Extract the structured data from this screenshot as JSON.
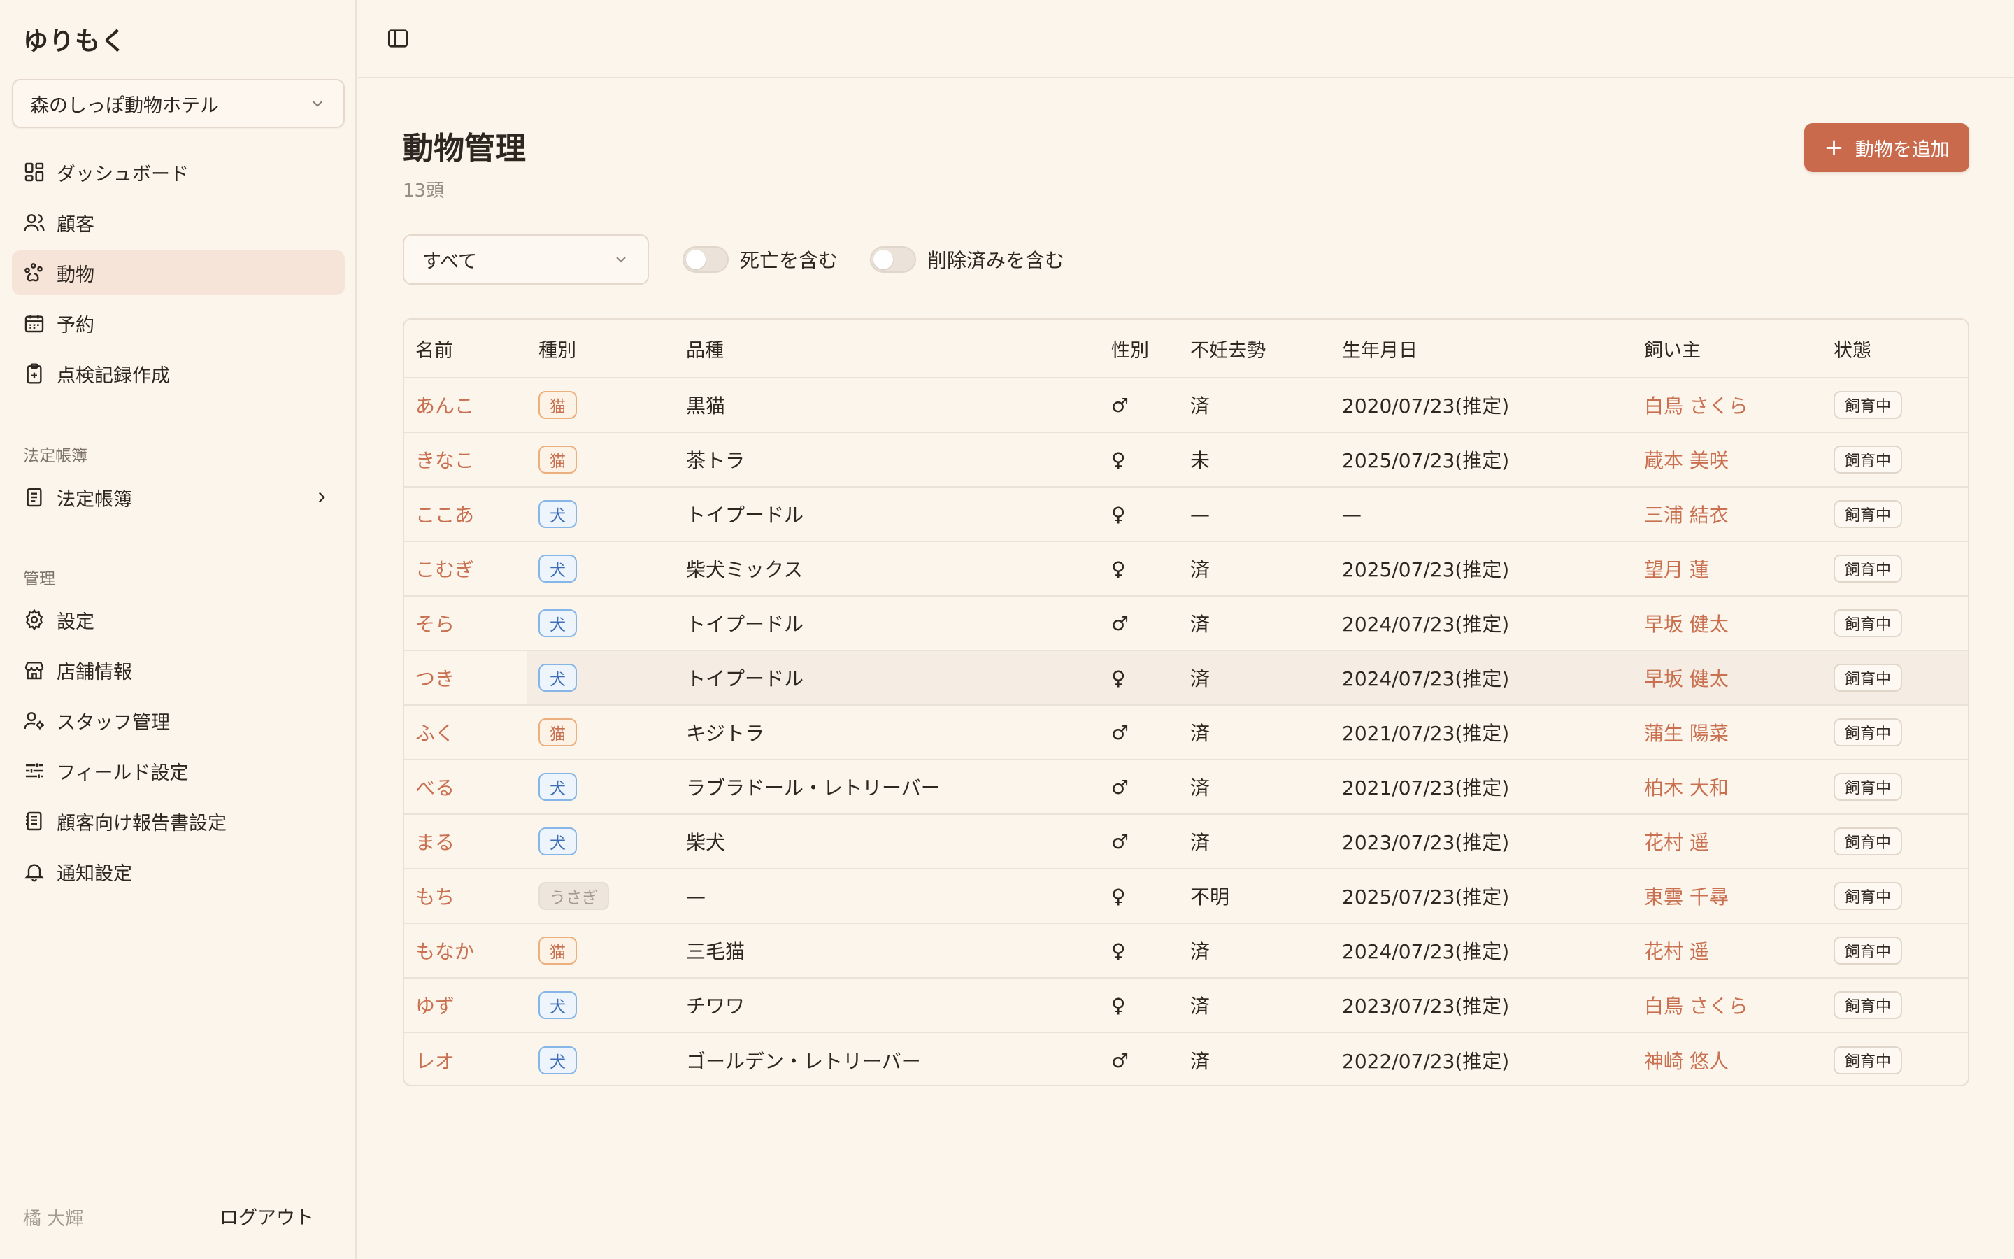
{
  "app": {
    "brand": "ゆりもく"
  },
  "sidebar": {
    "store": "森のしっぽ動物ホテル",
    "main_items": [
      {
        "label": "ダッシュボード",
        "icon": "dashboard-icon"
      },
      {
        "label": "顧客",
        "icon": "users-icon"
      },
      {
        "label": "動物",
        "icon": "paw-icon",
        "active": true
      },
      {
        "label": "予約",
        "icon": "calendar-icon"
      },
      {
        "label": "点検記録作成",
        "icon": "clipboard-plus-icon"
      }
    ],
    "section_legal": "法定帳簿",
    "legal_item": {
      "label": "法定帳簿",
      "icon": "ledger-icon"
    },
    "section_admin": "管理",
    "admin_items": [
      {
        "label": "設定",
        "icon": "gear-icon"
      },
      {
        "label": "店舗情報",
        "icon": "store-icon"
      },
      {
        "label": "スタッフ管理",
        "icon": "staff-icon"
      },
      {
        "label": "フィールド設定",
        "icon": "sliders-icon"
      },
      {
        "label": "顧客向け報告書設定",
        "icon": "report-icon"
      },
      {
        "label": "通知設定",
        "icon": "bell-icon"
      }
    ],
    "user": "橘 大輝",
    "logout": "ログアウト"
  },
  "main": {
    "title": "動物管理",
    "count": "13頭",
    "add_button": "動物を追加",
    "filter": {
      "selected": "すべて"
    },
    "toggles": [
      {
        "label": "死亡を含む",
        "on": false
      },
      {
        "label": "削除済みを含む",
        "on": false
      }
    ]
  },
  "table": {
    "headers": [
      "名前",
      "種別",
      "品種",
      "性別",
      "不妊去勢",
      "生年月日",
      "飼い主",
      "状態"
    ],
    "rows": [
      [
        "あんこ",
        "猫",
        "黒猫",
        "♂",
        "済",
        "2020/07/23(推定)",
        "白鳥 さくら",
        "飼育中"
      ],
      [
        "きなこ",
        "猫",
        "茶トラ",
        "♀",
        "未",
        "2025/07/23(推定)",
        "蔵本 美咲",
        "飼育中"
      ],
      [
        "ここあ",
        "犬",
        "トイプードル",
        "♀",
        "—",
        "—",
        "三浦 結衣",
        "飼育中"
      ],
      [
        "こむぎ",
        "犬",
        "柴犬ミックス",
        "♀",
        "済",
        "2025/07/23(推定)",
        "望月 蓮",
        "飼育中"
      ],
      [
        "そら",
        "犬",
        "トイプードル",
        "♂",
        "済",
        "2024/07/23(推定)",
        "早坂 健太",
        "飼育中"
      ],
      [
        "つき",
        "犬",
        "トイプードル",
        "♀",
        "済",
        "2024/07/23(推定)",
        "早坂 健太",
        "飼育中"
      ],
      [
        "ふく",
        "猫",
        "キジトラ",
        "♂",
        "済",
        "2021/07/23(推定)",
        "蒲生 陽菜",
        "飼育中"
      ],
      [
        "べる",
        "犬",
        "ラブラドール・レトリーバー",
        "♂",
        "済",
        "2021/07/23(推定)",
        "柏木 大和",
        "飼育中"
      ],
      [
        "まる",
        "犬",
        "柴犬",
        "♂",
        "済",
        "2023/07/23(推定)",
        "花村 遥",
        "飼育中"
      ],
      [
        "もち",
        "うさぎ",
        "—",
        "♀",
        "不明",
        "2025/07/23(推定)",
        "東雲 千尋",
        "飼育中"
      ],
      [
        "もなか",
        "猫",
        "三毛猫",
        "♀",
        "済",
        "2024/07/23(推定)",
        "花村 遥",
        "飼育中"
      ],
      [
        "ゆず",
        "犬",
        "チワワ",
        "♀",
        "済",
        "2023/07/23(推定)",
        "白鳥 さくら",
        "飼育中"
      ],
      [
        "レオ",
        "犬",
        "ゴールデン・レトリーバー",
        "♂",
        "済",
        "2022/07/23(推定)",
        "神崎 悠人",
        "飼育中"
      ]
    ]
  },
  "colors": {
    "accent": "#c96a4c",
    "link": "#c8704f",
    "background": "#fcf5ec",
    "active_nav": "#f6e4d8"
  }
}
